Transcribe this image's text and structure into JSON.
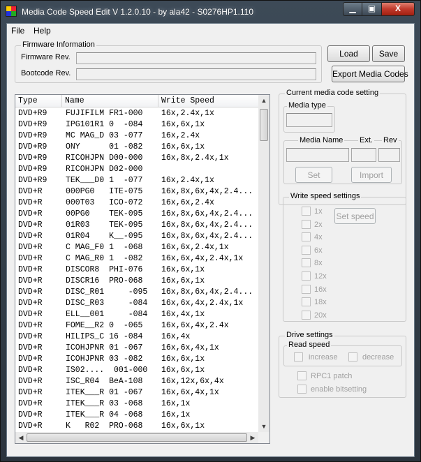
{
  "window": {
    "title": "Media Code Speed Edit V 1.2.0.10 - by ala42 - S0276HP1.110",
    "minimize": "▁",
    "maximize": "▣",
    "close": "X"
  },
  "menu": {
    "file": "File",
    "help": "Help"
  },
  "firmware": {
    "group_title": "Firmware Information",
    "firmware_rev_label": "Firmware Rev.",
    "firmware_rev_value": "",
    "bootcode_rev_label": "Bootcode Rev.",
    "bootcode_rev_value": ""
  },
  "buttons": {
    "load": "Load",
    "save": "Save",
    "export": "Export Media Codes"
  },
  "list": {
    "columns": [
      "Type",
      "Name",
      "Write Speed"
    ],
    "rows": [
      [
        "DVD+R9",
        "FUJIFILM FR1-000",
        "16x,2.4x,1x"
      ],
      [
        "DVD+R9",
        "IPG101R1 0  -084",
        "16x,6x,1x"
      ],
      [
        "DVD+R9",
        "MC MAG_D 03 -077",
        "16x,2.4x"
      ],
      [
        "DVD+R9",
        "ONY      01 -082",
        "16x,6x,1x"
      ],
      [
        "DVD+R9",
        "RICOHJPN D00-000",
        "16x,8x,2.4x,1x"
      ],
      [
        "DVD+R9",
        "RICOHJPN D02-000",
        ""
      ],
      [
        "DVD+R9",
        "TEK___D0 1  -077",
        "16x,2.4x,1x"
      ],
      [
        "DVD+R",
        "000PG0   ITE-075",
        "16x,8x,6x,4x,2.4..."
      ],
      [
        "DVD+R",
        "000T03   ICO-072",
        "16x,6x,2.4x"
      ],
      [
        "DVD+R",
        "00PG0    TEK-095",
        "16x,8x,6x,4x,2.4..."
      ],
      [
        "DVD+R",
        "01R03    TEK-095",
        "16x,8x,6x,4x,2.4..."
      ],
      [
        "DVD+R",
        "01R04    K__-095",
        "16x,8x,6x,4x,2.4..."
      ],
      [
        "DVD+R",
        "C MAG_F0 1  -068",
        "16x,6x,2.4x,1x"
      ],
      [
        "DVD+R",
        "C MAG_R0 1  -082",
        "16x,6x,4x,2.4x,1x"
      ],
      [
        "DVD+R",
        "DISCOR8  PHI-076",
        "16x,6x,1x"
      ],
      [
        "DVD+R",
        "DISCR16  PRO-068",
        "16x,6x,1x"
      ],
      [
        "DVD+R",
        "DISC_R01     -095",
        "16x,8x,6x,4x,2.4..."
      ],
      [
        "DVD+R",
        "DISC_R03     -084",
        "16x,6x,4x,2.4x,1x"
      ],
      [
        "DVD+R",
        "ELL__001     -084",
        "16x,4x,1x"
      ],
      [
        "DVD+R",
        "FOME__R2 0  -065",
        "16x,6x,4x,2.4x"
      ],
      [
        "DVD+R",
        "HILIPS_C 16 -084",
        "16x,4x"
      ],
      [
        "DVD+R",
        "ICOHJPNR 01 -067",
        "16x,6x,4x,1x"
      ],
      [
        "DVD+R",
        "ICOHJPNR 03 -082",
        "16x,6x,1x"
      ],
      [
        "DVD+R",
        "IS02....  001-000",
        "16x,6x,1x"
      ],
      [
        "DVD+R",
        "ISC_R04  BeA-108",
        "16x,12x,6x,4x"
      ],
      [
        "DVD+R",
        "ITEK___R 01 -067",
        "16x,6x,4x,1x"
      ],
      [
        "DVD+R",
        "ITEK___R 03 -068",
        "16x,1x"
      ],
      [
        "DVD+R",
        "ITEK___R 04 -068",
        "16x,1x"
      ],
      [
        "DVD+R",
        "K   R02  PRO-068",
        "16x,6x,1x"
      ]
    ]
  },
  "current_media": {
    "group_title": "Current media code setting",
    "media_type_label": "Media type",
    "media_name_label": "Media Name",
    "ext_label": "Ext.",
    "rev_label": "Rev",
    "set_button": "Set",
    "import_button": "Import"
  },
  "write_speed": {
    "group_title": "Write speed settings",
    "speeds": [
      "1x",
      "2x",
      "4x",
      "6x",
      "8x",
      "12x",
      "16x",
      "18x",
      "20x"
    ],
    "set_speed_button": "Set speed"
  },
  "drive": {
    "group_title": "Drive settings",
    "read_speed_title": "Read speed",
    "increase": "increase",
    "decrease": "decrease",
    "rpc1_patch": "RPC1 patch",
    "enable_bitsetting": "enable bitsetting"
  }
}
